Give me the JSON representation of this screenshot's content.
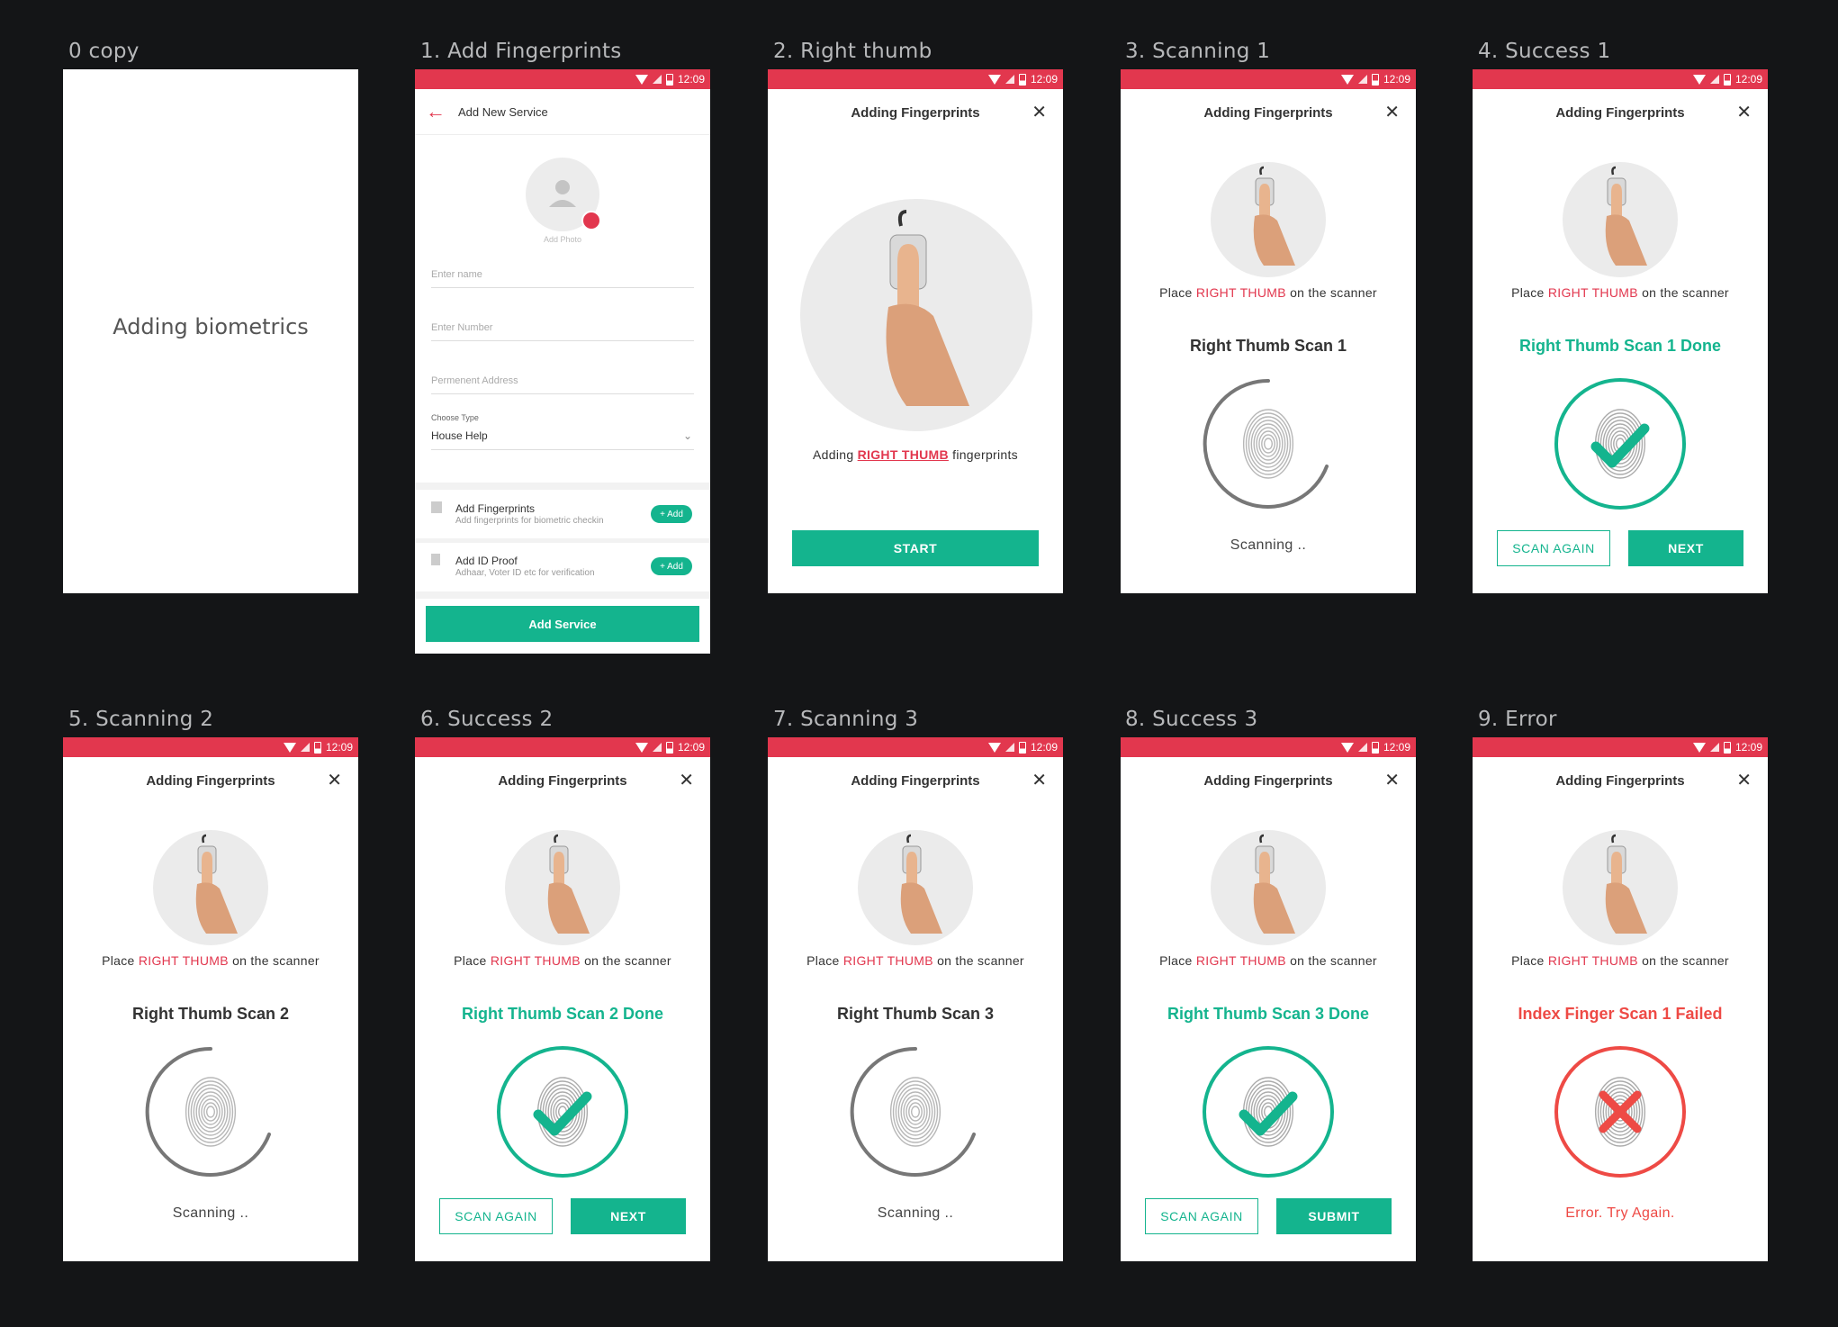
{
  "status_time": "12:09",
  "colors": {
    "brand": "#e2374e",
    "success": "#14b48e",
    "error": "#ee4a45"
  },
  "artboards": [
    {
      "label": "0 copy",
      "text": "Adding biometrics"
    },
    {
      "label": "1. Add Fingerprints"
    },
    {
      "label": "2. Right thumb"
    },
    {
      "label": "3. Scanning 1"
    },
    {
      "label": "4. Success 1"
    },
    {
      "label": "5. Scanning 2"
    },
    {
      "label": "6. Success 2"
    },
    {
      "label": "7. Scanning 3"
    },
    {
      "label": "8. Success 3"
    },
    {
      "label": "9. Error"
    }
  ],
  "form": {
    "title": "Add New Service",
    "add_photo": "Add Photo",
    "name_placeholder": "Enter name",
    "number_placeholder": "Enter Number",
    "address_placeholder": "Permenent Address",
    "type_label": "Choose Type",
    "type_value": "House Help",
    "fingerprints_title": "Add Fingerprints",
    "fingerprints_sub": "Add fingerprints for biometric checkin",
    "id_title": "Add ID Proof",
    "id_sub": "Adhaar, Voter ID etc for verification",
    "add_pill": "+ Add",
    "submit": "Add Service"
  },
  "modal": {
    "title": "Adding Fingerprints",
    "adding_prefix": "Adding",
    "adding_highlight": "RIGHT THUMB",
    "adding_suffix": "fingerprints",
    "start": "START",
    "place_prefix": "Place",
    "place_highlight": "RIGHT THUMB",
    "place_suffix": "on the scanner",
    "scanning": "Scanning ..",
    "scan_again": "SCAN AGAIN",
    "next": "NEXT",
    "submit": "SUBMIT",
    "error_msg": "Error. Try Again."
  },
  "scans": {
    "scan1": "Right Thumb Scan 1",
    "done1": "Right Thumb Scan 1 Done",
    "scan2": "Right Thumb Scan 2",
    "done2": "Right Thumb Scan 2 Done",
    "scan3": "Right Thumb Scan 3",
    "done3": "Right Thumb Scan 3 Done",
    "failed": "Index Finger Scan 1 Failed"
  }
}
